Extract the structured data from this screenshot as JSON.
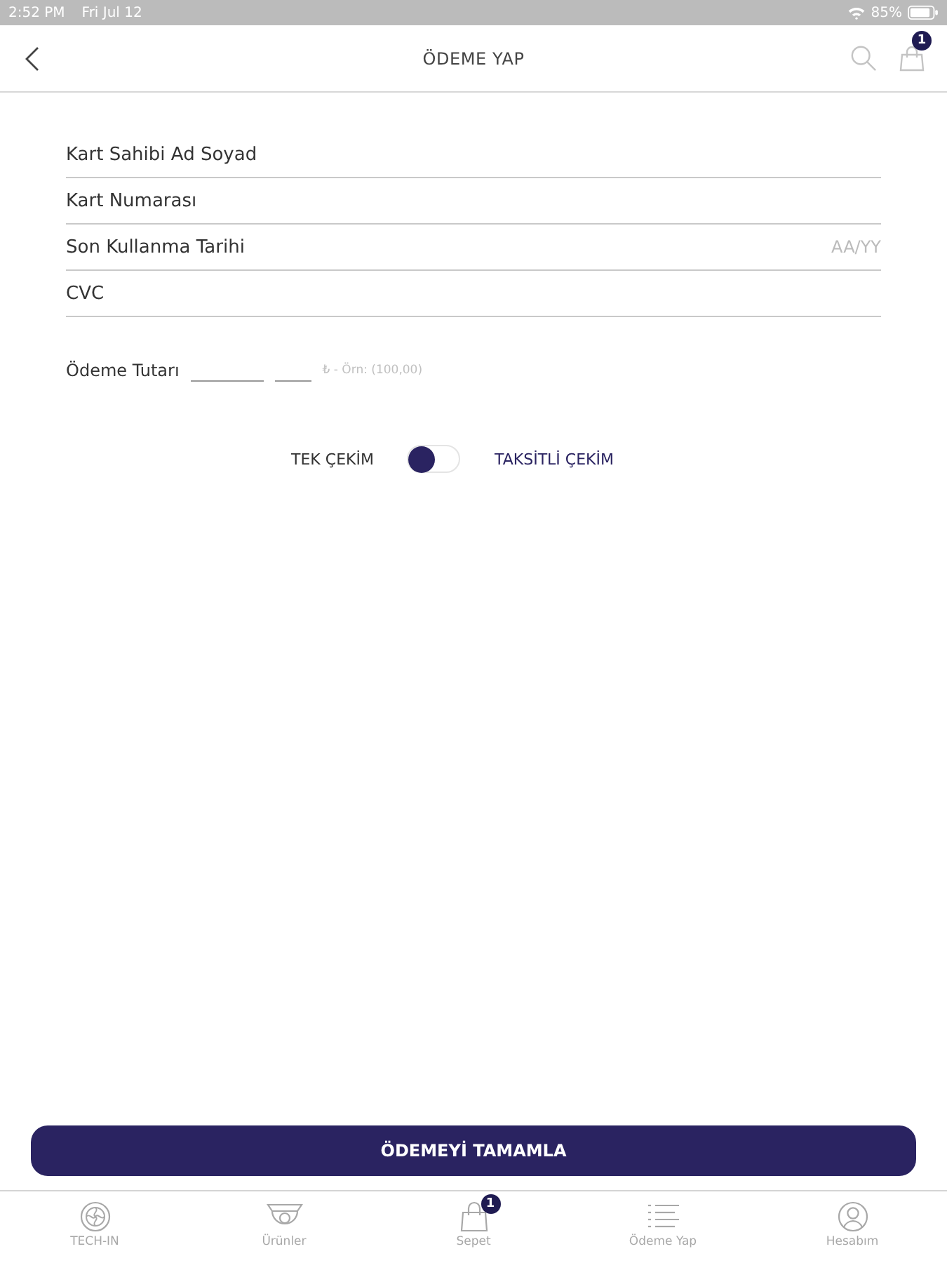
{
  "status_bar": {
    "time": "2:52 PM",
    "date": "Fri Jul 12",
    "battery": "85%"
  },
  "header": {
    "title": "ÖDEME YAP",
    "bag_badge": "1"
  },
  "card_fields": [
    {
      "placeholder": "Kart Sahibi Ad Soyad"
    },
    {
      "placeholder": "Kart Numarası"
    },
    {
      "placeholder": "Son Kullanma Tarihi",
      "hint": "AA/YY"
    },
    {
      "placeholder": "CVC"
    }
  ],
  "amount": {
    "label": "Ödeme Tutarı",
    "hint": "₺ - Örn: (100,00)"
  },
  "payment_type": {
    "left_label": "TEK ÇEKİM",
    "right_label": "TAKSİTLİ ÇEKİM",
    "on": false
  },
  "submit_button": "ÖDEMEYİ TAMAMLA",
  "tab_bar": [
    {
      "kind": "logo",
      "label": "TECH-IN",
      "selected": false
    },
    {
      "kind": "camera",
      "label": "Ürünler",
      "selected": false
    },
    {
      "kind": "bag",
      "label": "Sepet",
      "badge": "1",
      "selected": false
    },
    {
      "kind": "list",
      "label": "Ödeme Yap",
      "selected": false
    },
    {
      "kind": "account",
      "label": "Hesabım",
      "selected": false
    }
  ]
}
